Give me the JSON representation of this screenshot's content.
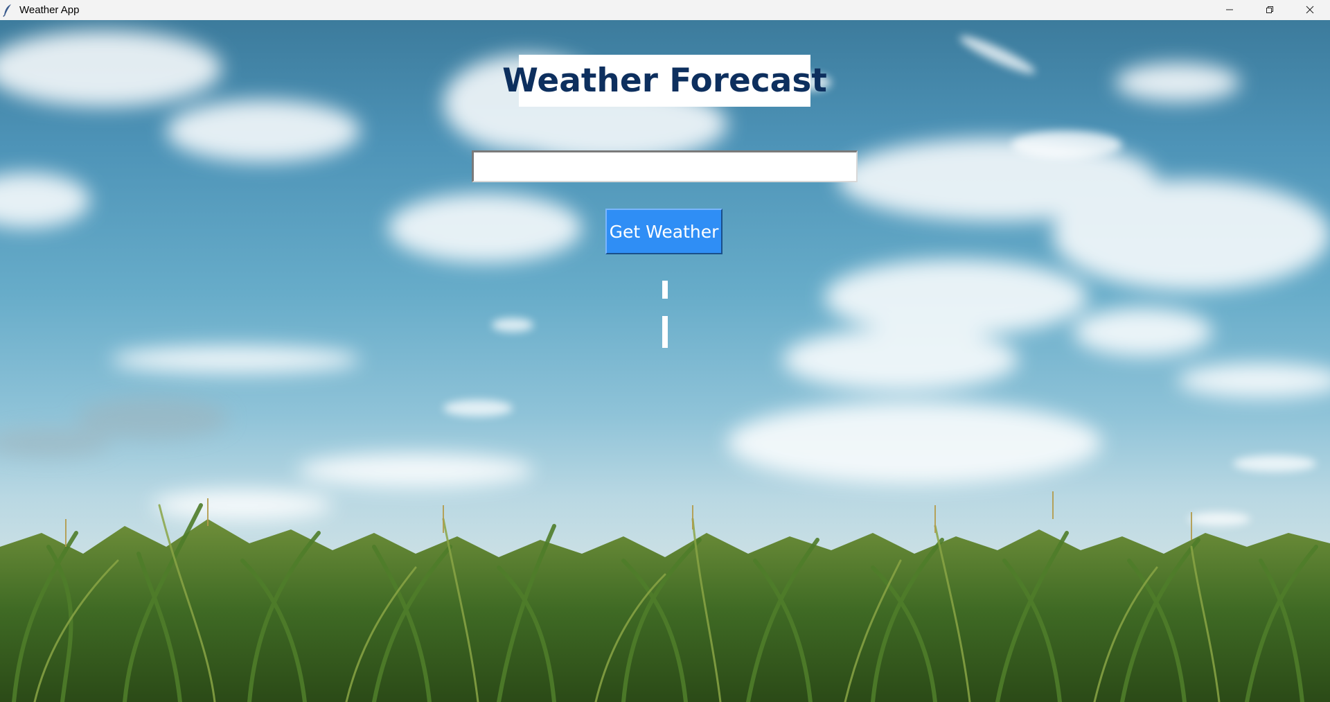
{
  "window": {
    "title": "Weather App",
    "app_icon": "feather-icon",
    "controls": [
      "minimize-icon",
      "restore-icon",
      "close-icon"
    ]
  },
  "main": {
    "heading": "Weather Forecast",
    "city_input": {
      "value": "",
      "placeholder": ""
    },
    "get_weather_label": "Get Weather",
    "temperature_text": "",
    "description_text": ""
  },
  "colors": {
    "heading_text": "#0d2f5e",
    "button_bg": "#2f8ef5",
    "button_text": "#ffffff",
    "titlebar_bg": "#f3f3f3"
  },
  "background": "sky-with-clouds-over-cornfield"
}
